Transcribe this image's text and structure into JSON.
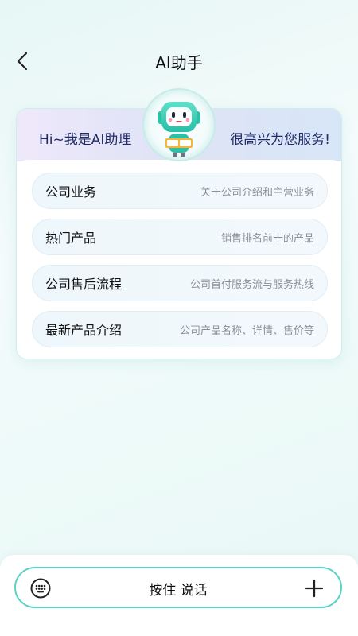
{
  "header": {
    "title": "AI助手",
    "back_icon": "chevron-left-icon"
  },
  "greeting": {
    "left": "Hi~我是AI助理",
    "right": "很高兴为您服务!",
    "avatar_icon": "robot-avatar-icon"
  },
  "menu": {
    "items": [
      {
        "title": "公司业务",
        "desc": "关于公司介绍和主营业务"
      },
      {
        "title": "热门产品",
        "desc": "销售排名前十的产品"
      },
      {
        "title": "公司售后流程",
        "desc": "公司首付服务流与服务热线"
      },
      {
        "title": "最新产品介绍",
        "desc": "公司产品名称、详情、售价等"
      }
    ]
  },
  "input_bar": {
    "hold_to_talk": "按住 说话",
    "keyboard_icon": "keyboard-icon",
    "plus_icon": "plus-icon"
  },
  "colors": {
    "accent": "#5ad3c2",
    "robot_body": "#3ccfb4",
    "greeting_text": "#1f2a66"
  }
}
